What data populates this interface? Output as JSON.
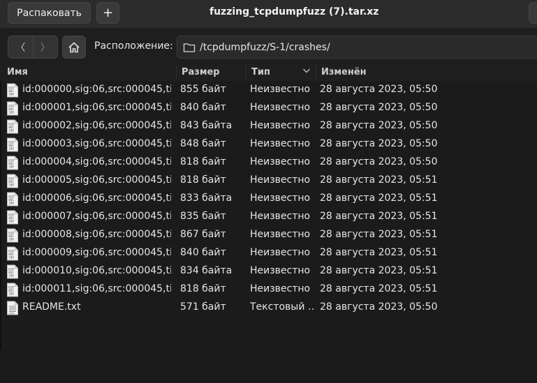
{
  "header": {
    "extract_label": "Распаковать",
    "add_label": "+",
    "title": "fuzzing_tcpdumpfuzz (7).tar.xz"
  },
  "toolbar": {
    "back_glyph": "〈",
    "forward_glyph": "〉",
    "location_label": "Расположение:",
    "path": "/tcpdumpfuzz/S-1/crashes/"
  },
  "table": {
    "columns": {
      "name": "Имя",
      "size": "Размер",
      "type": "Тип",
      "modified": "Изменён"
    },
    "rows": [
      {
        "icon": "binary-file-icon",
        "name": "id:000000,sig:06,src:000045,ti…",
        "size": "855 байт",
        "type": "Неизвестно",
        "modified": "28 августа 2023, 05:50"
      },
      {
        "icon": "binary-file-icon",
        "name": "id:000001,sig:06,src:000045,ti…",
        "size": "840 байт",
        "type": "Неизвестно",
        "modified": "28 августа 2023, 05:50"
      },
      {
        "icon": "binary-file-icon",
        "name": "id:000002,sig:06,src:000045,ti…",
        "size": "843 байта",
        "type": "Неизвестно",
        "modified": "28 августа 2023, 05:50"
      },
      {
        "icon": "binary-file-icon",
        "name": "id:000003,sig:06,src:000045,ti…",
        "size": "848 байт",
        "type": "Неизвестно",
        "modified": "28 августа 2023, 05:50"
      },
      {
        "icon": "binary-file-icon",
        "name": "id:000004,sig:06,src:000045,ti…",
        "size": "818 байт",
        "type": "Неизвестно",
        "modified": "28 августа 2023, 05:50"
      },
      {
        "icon": "binary-file-icon",
        "name": "id:000005,sig:06,src:000045,ti…",
        "size": "818 байт",
        "type": "Неизвестно",
        "modified": "28 августа 2023, 05:51"
      },
      {
        "icon": "binary-file-icon",
        "name": "id:000006,sig:06,src:000045,ti…",
        "size": "833 байта",
        "type": "Неизвестно",
        "modified": "28 августа 2023, 05:51"
      },
      {
        "icon": "binary-file-icon",
        "name": "id:000007,sig:06,src:000045,ti…",
        "size": "835 байт",
        "type": "Неизвестно",
        "modified": "28 августа 2023, 05:51"
      },
      {
        "icon": "binary-file-icon",
        "name": "id:000008,sig:06,src:000045,ti…",
        "size": "867 байт",
        "type": "Неизвестно",
        "modified": "28 августа 2023, 05:51"
      },
      {
        "icon": "binary-file-icon",
        "name": "id:000009,sig:06,src:000045,ti…",
        "size": "840 байт",
        "type": "Неизвестно",
        "modified": "28 августа 2023, 05:51"
      },
      {
        "icon": "binary-file-icon",
        "name": "id:000010,sig:06,src:000045,ti…",
        "size": "834 байта",
        "type": "Неизвестно",
        "modified": "28 августа 2023, 05:51"
      },
      {
        "icon": "binary-file-icon",
        "name": "id:000011,sig:06,src:000045,ti…",
        "size": "818 байт",
        "type": "Неизвестно",
        "modified": "28 августа 2023, 05:51"
      },
      {
        "icon": "text-file-icon",
        "name": "README.txt",
        "size": "571 байт",
        "type": "Текстовый …",
        "modified": "28 августа 2023, 05:50"
      }
    ]
  },
  "colors": {
    "background": "#1b1b1b",
    "headerbar": "#2b2b2b",
    "text": "#e6e6e6"
  }
}
